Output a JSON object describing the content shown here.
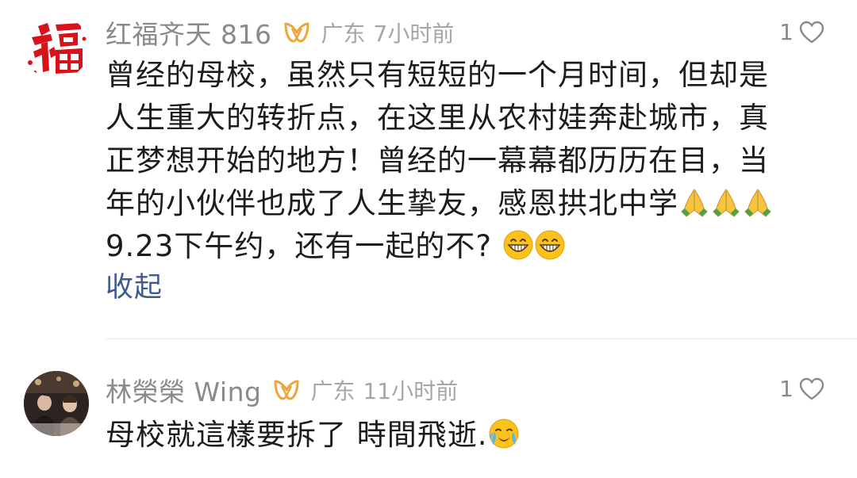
{
  "comments": [
    {
      "username": "红福齐天 816",
      "location": "广东",
      "time": "7小时前",
      "likes": "1",
      "avatar_icon": "red-fu-calligraphy-avatar",
      "badge_icon": "fan-badge-icon",
      "lines": [
        "曾经的母校，虽然只有短短的一个月时间，但却是",
        "人生重大的转折点，在这里从农村娃奔赴城市，真",
        "正梦想开始的地方！曾经的一幕幕都历历在目，当",
        "年的小伙伴也成了人生挚友，感恩拱北中学",
        "9.23下午约，还有一起的不?"
      ],
      "line4_emoji": [
        "folded-hands-emoji",
        "folded-hands-emoji",
        "folded-hands-emoji"
      ],
      "line5_emoji": [
        "grinning-face-emoji",
        "grinning-face-emoji"
      ],
      "collapse_label": "收起"
    },
    {
      "username": "林榮榮 Wing",
      "location": "广东",
      "time": "11小时前",
      "likes": "1",
      "avatar_icon": "photo-avatar",
      "badge_icon": "fan-badge-icon",
      "lines": [
        "母校就這樣要拆了 時間飛逝."
      ],
      "line1_emoji": [
        "loudly-crying-face-emoji"
      ]
    }
  ],
  "colors": {
    "username": "#8a8a8a",
    "body_text": "#1c1c1c",
    "link": "#3e5b8e",
    "badge": "#f0a53a",
    "divider": "#e8e8e8"
  }
}
